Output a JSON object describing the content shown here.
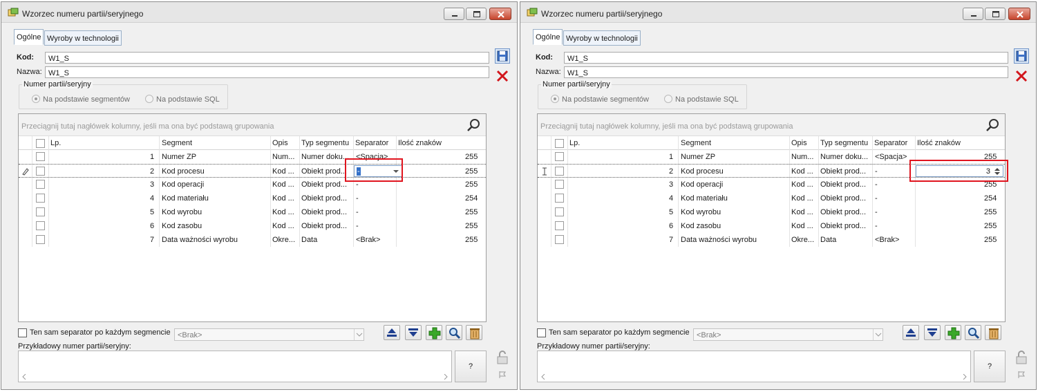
{
  "windows": [
    {
      "title": "Wzorzec numeru partii/seryjnego",
      "tabs": [
        "Ogólne",
        "Wyroby w technologii"
      ],
      "kod_label": "Kod:",
      "kod_value": "W1_S",
      "nazwa_label": "Nazwa:",
      "nazwa_value": "W1_S",
      "group_title": "Numer partii/seryjny",
      "radio1": "Na podstawie segmentów",
      "radio2": "Na podstawie SQL",
      "grid_hint": "Przeciągnij tutaj nagłówek kolumny, jeśli ma ona być podstawą grupowania",
      "columns": [
        "Lp.",
        "Segment",
        "Opis",
        "Typ segmentu",
        "Separator",
        "Ilość znaków"
      ],
      "rows": [
        {
          "lp": "1",
          "segment": "Numer ZP",
          "opis": "Num...",
          "typ": "Numer doku...",
          "sep": "<Spacja>",
          "ilosc": "255"
        },
        {
          "lp": "2",
          "segment": "Kod procesu",
          "opis": "Kod ...",
          "typ": "Obiekt prod...",
          "sep": "-",
          "ilosc": "255"
        },
        {
          "lp": "3",
          "segment": "Kod operacji",
          "opis": "Kod ...",
          "typ": "Obiekt prod...",
          "sep": "-",
          "ilosc": "255"
        },
        {
          "lp": "4",
          "segment": "Kod materiału",
          "opis": "Kod ...",
          "typ": "Obiekt prod...",
          "sep": "-",
          "ilosc": "254"
        },
        {
          "lp": "5",
          "segment": "Kod wyrobu",
          "opis": "Kod ...",
          "typ": "Obiekt prod...",
          "sep": "-",
          "ilosc": "255"
        },
        {
          "lp": "6",
          "segment": "Kod zasobu",
          "opis": "Kod ...",
          "typ": "Obiekt prod...",
          "sep": "-",
          "ilosc": "255"
        },
        {
          "lp": "7",
          "segment": "Data ważności wyrobu",
          "opis": "Okre...",
          "typ": "Data",
          "sep": "<Brak>",
          "ilosc": "255"
        }
      ],
      "bottom_checkbox": "Ten sam separator po każdym segmencie",
      "combo_value": "<Brak>",
      "sample_label": "Przykładowy numer partii/seryjny:",
      "q_button": "?",
      "editor": {
        "row": 2,
        "column": "separator",
        "value": "-"
      }
    },
    {
      "title": "Wzorzec numeru partii/seryjnego",
      "tabs": [
        "Ogólne",
        "Wyroby w technologii"
      ],
      "kod_label": "Kod:",
      "kod_value": "W1_S",
      "nazwa_label": "Nazwa:",
      "nazwa_value": "W1_S",
      "group_title": "Numer partii/seryjny",
      "radio1": "Na podstawie segmentów",
      "radio2": "Na podstawie SQL",
      "grid_hint": "Przeciągnij tutaj nagłówek kolumny, jeśli ma ona być podstawą grupowania",
      "columns": [
        "Lp.",
        "Segment",
        "Opis",
        "Typ segmentu",
        "Separator",
        "Ilość znaków"
      ],
      "rows": [
        {
          "lp": "1",
          "segment": "Numer ZP",
          "opis": "Num...",
          "typ": "Numer doku...",
          "sep": "<Spacja>",
          "ilosc": "255"
        },
        {
          "lp": "2",
          "segment": "Kod procesu",
          "opis": "Kod ...",
          "typ": "Obiekt prod...",
          "sep": "-",
          "ilosc": "3"
        },
        {
          "lp": "3",
          "segment": "Kod operacji",
          "opis": "Kod ...",
          "typ": "Obiekt prod...",
          "sep": "-",
          "ilosc": "255"
        },
        {
          "lp": "4",
          "segment": "Kod materiału",
          "opis": "Kod ...",
          "typ": "Obiekt prod...",
          "sep": "-",
          "ilosc": "254"
        },
        {
          "lp": "5",
          "segment": "Kod wyrobu",
          "opis": "Kod ...",
          "typ": "Obiekt prod...",
          "sep": "-",
          "ilosc": "255"
        },
        {
          "lp": "6",
          "segment": "Kod zasobu",
          "opis": "Kod ...",
          "typ": "Obiekt prod...",
          "sep": "-",
          "ilosc": "255"
        },
        {
          "lp": "7",
          "segment": "Data ważności wyrobu",
          "opis": "Okre...",
          "typ": "Data",
          "sep": "<Brak>",
          "ilosc": "255"
        }
      ],
      "bottom_checkbox": "Ten sam separator po każdym segmencie",
      "combo_value": "<Brak>",
      "sample_label": "Przykładowy numer partii/seryjny:",
      "q_button": "?",
      "editor": {
        "row": 2,
        "column": "ilosc",
        "value": "3"
      }
    }
  ],
  "icons": [
    "app-icon",
    "minimize-icon",
    "maximize-icon",
    "close-icon",
    "save-icon",
    "cancel-icon",
    "search-icon",
    "move-up-icon",
    "move-down-icon",
    "add-icon",
    "preview-icon",
    "delete-icon",
    "lock-icon",
    "pin-icon",
    "pencil-icon",
    "text-cursor-icon"
  ],
  "colors": {
    "accent_red": "#e0141e",
    "add_green": "#3aa829",
    "close_button": "#c7442c"
  }
}
